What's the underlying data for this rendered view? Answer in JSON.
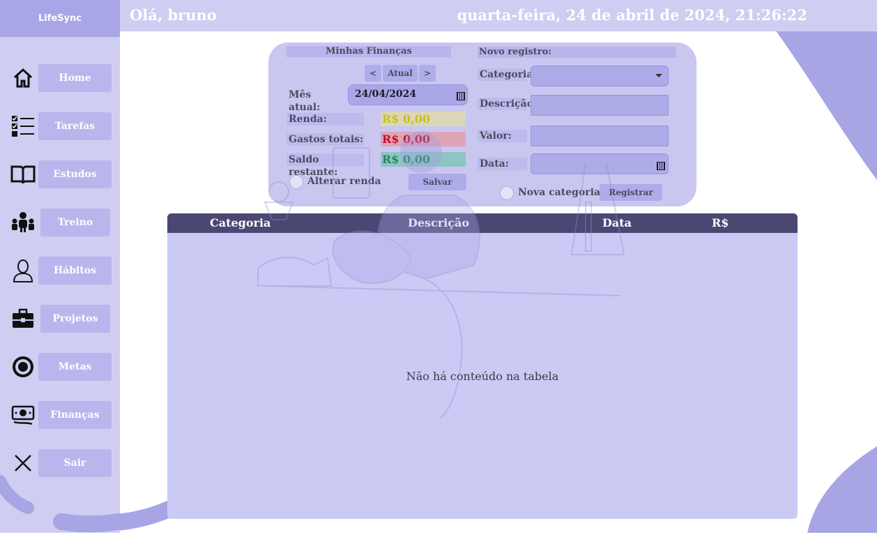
{
  "app": {
    "name": "LifeSync"
  },
  "header": {
    "greeting": "Olá, bruno",
    "datetime": "quarta-feira, 24 de abril de 2024, 21:26:22"
  },
  "sidebar": {
    "items": [
      {
        "label": "Home",
        "icon": "home-icon"
      },
      {
        "label": "Tarefas",
        "icon": "checklist-icon"
      },
      {
        "label": "Estudos",
        "icon": "book-icon"
      },
      {
        "label": "Treino",
        "icon": "group-icon"
      },
      {
        "label": "Hábitos",
        "icon": "person-icon"
      },
      {
        "label": "Projetos",
        "icon": "briefcase-icon"
      },
      {
        "label": "Metas",
        "icon": "target-icon"
      },
      {
        "label": "Finanças",
        "icon": "money-icon"
      },
      {
        "label": "Sair",
        "icon": "close-icon"
      }
    ]
  },
  "finance": {
    "title": "Minhas Finanças",
    "nav_prev": "<",
    "nav_current": "Atual",
    "nav_next": ">",
    "month_label": "Mês atual:",
    "month_value": "24/04/2024",
    "income_label": "Renda:",
    "income_value": "R$ 0,00",
    "expenses_label": "Gastos totais:",
    "expenses_value": "R$ 0,00",
    "balance_label": "Saldo restante:",
    "balance_value": "R$ 0,00",
    "change_income_label": "Alterar renda",
    "save_label": "Salvar"
  },
  "new_record": {
    "title": "Novo registro:",
    "category_label": "Categoria",
    "category_value": "",
    "description_label": "Descrição:",
    "description_value": "",
    "value_label": "Valor:",
    "value_value": "",
    "date_label": "Data:",
    "date_value": "",
    "new_category_label": "Nova categoria",
    "register_label": "Registrar"
  },
  "table": {
    "columns": [
      "Categoria",
      "Descrição",
      "Data",
      "R$"
    ],
    "rows": [],
    "empty_message": "Não há conteúdo na tabela"
  },
  "colors": {
    "income": "#c7c21a",
    "expenses": "#c0102a",
    "balance": "#1e8a5c",
    "table_header": "#4a4773",
    "accent": "#a8a6e6"
  }
}
